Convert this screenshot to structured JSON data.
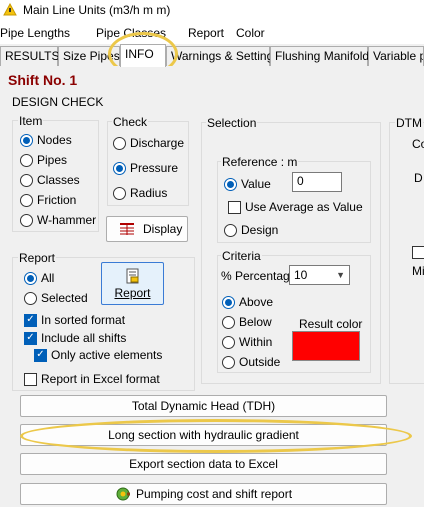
{
  "window": {
    "title": "Main Line  Units (m3/h  m  m)"
  },
  "menu": [
    "Pipe Lengths",
    "Pipe Classes",
    "Report",
    "Color"
  ],
  "tabs": [
    "RESULTS",
    "Size Pipes",
    "INFO",
    "Warnings & Settings",
    "Flushing Manifolds",
    "Variable pr"
  ],
  "active_tab": "INFO",
  "shift_title": "Shift No. 1",
  "design_check": {
    "label": "DESIGN CHECK",
    "item": {
      "label": "Item",
      "options": [
        "Nodes",
        "Pipes",
        "Classes",
        "Friction",
        "W-hammer"
      ],
      "selected": "Nodes"
    },
    "check": {
      "label": "Check",
      "options": [
        "Discharge",
        "Pressure",
        "Radius"
      ],
      "selected": "Pressure"
    },
    "display_button": "Display",
    "report": {
      "label": "Report",
      "options": [
        "All",
        "Selected"
      ],
      "selected": "All",
      "report_button": "Report",
      "checkboxes": [
        {
          "label": "In sorted format",
          "checked": true
        },
        {
          "label": "Include all shifts",
          "checked": true
        },
        {
          "label": "Only active elements",
          "checked": true
        },
        {
          "label": "Report in Excel format",
          "checked": false
        }
      ]
    },
    "selection": {
      "label": "Selection",
      "reference": {
        "label": "Reference : m",
        "value_label": "Value",
        "value": "0",
        "avg_label": "Use Average as Value",
        "avg_checked": false,
        "design_label": "Design",
        "selected": "Value"
      },
      "criteria": {
        "label": "Criteria",
        "percentage_label": "% Percentage",
        "percentage_value": "10",
        "options": [
          "Above",
          "Below",
          "Within",
          "Outside"
        ],
        "selected": "Above",
        "result_color_label": "Result color",
        "result_color": "#ff0000"
      }
    },
    "dtm": {
      "label": "DTM",
      "fragments": [
        "Co",
        "D",
        "Mi"
      ]
    }
  },
  "buttons": {
    "tdh": "Total Dynamic Head (TDH)",
    "long_section": "Long section with hydraulic gradient",
    "export": "Export section data to Excel",
    "pumping": "Pumping cost and shift report"
  },
  "colors": {
    "accent": "#005fb8",
    "highlight": "#ecc84a",
    "title_red": "#8b0000"
  }
}
